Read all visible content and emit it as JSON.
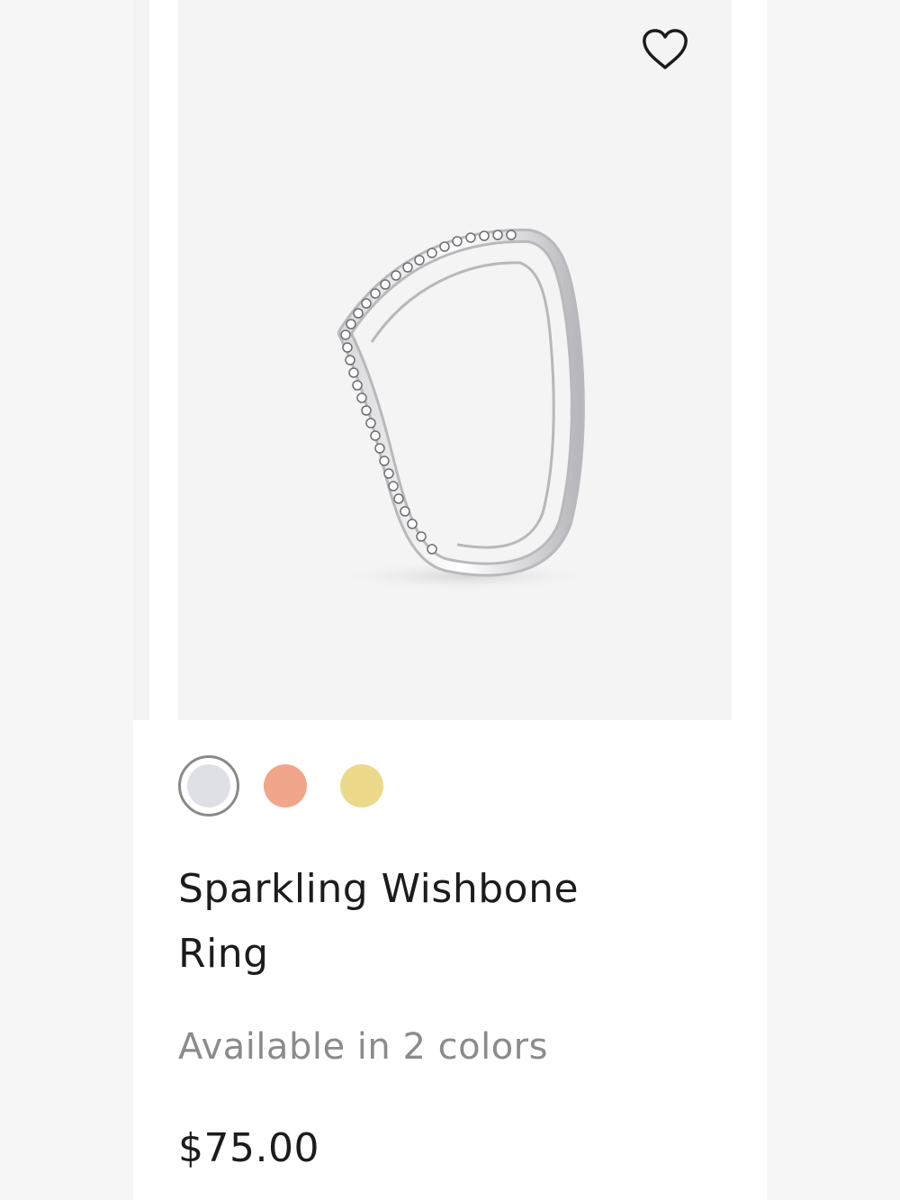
{
  "product": {
    "title": "Sparkling Wishbone Ring",
    "availability": "Available in 2 colors",
    "price": "$75.00",
    "image_alt": "ring-product-image",
    "wishlist_icon": "heart-outline-icon"
  },
  "swatches": [
    {
      "name": "silver",
      "color": "#dfe0e5",
      "selected": true
    },
    {
      "name": "rose-gold",
      "color": "#f1a58a",
      "selected": false
    },
    {
      "name": "gold",
      "color": "#ecd98a",
      "selected": false
    }
  ],
  "colors": {
    "title_text": "#1d1b1c",
    "muted_text": "#8b8b8b",
    "image_bg": "#f4f4f4",
    "selected_ring": "#8a8a8c"
  }
}
